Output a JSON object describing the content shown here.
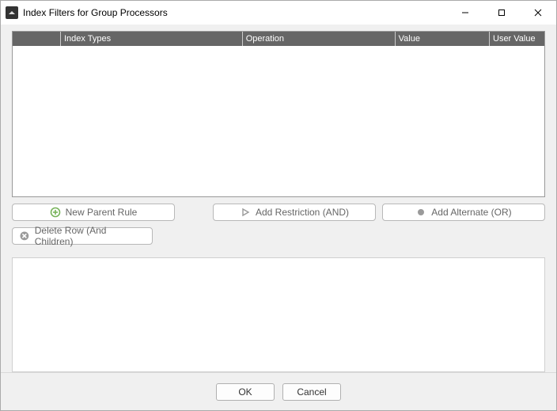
{
  "window": {
    "title": "Index Filters for Group Processors"
  },
  "grid": {
    "headers": {
      "col0": "",
      "col1": "Index Types",
      "col2": "Operation",
      "col3": "Value",
      "col4": "User Value"
    }
  },
  "buttons": {
    "new_parent": "New Parent Rule",
    "add_restriction": "Add Restriction (AND)",
    "add_alternate": "Add Alternate (OR)",
    "delete_row": "Delete Row (And Children)"
  },
  "dialog": {
    "ok": "OK",
    "cancel": "Cancel"
  },
  "colors": {
    "iconGreen": "#77b35a",
    "iconGray": "#9a9a9a"
  }
}
